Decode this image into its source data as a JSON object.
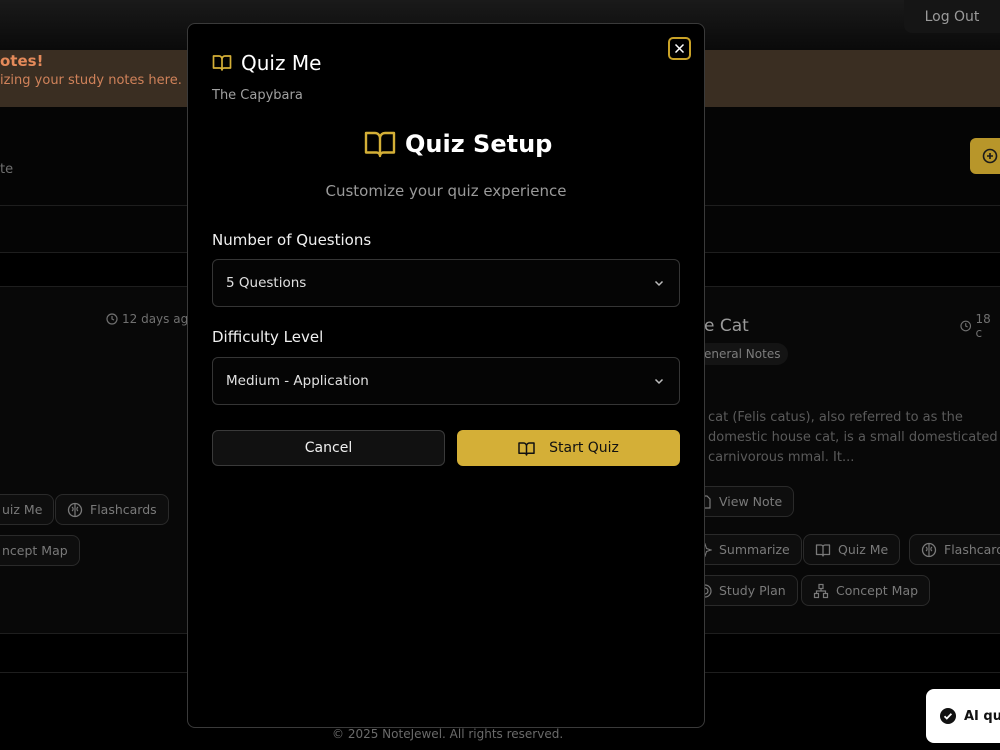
{
  "header": {
    "logout_label": "Log Out"
  },
  "banner": {
    "title": "otes!",
    "text": "izing your study notes here."
  },
  "section": {
    "partial_text": "te",
    "add_icon": "plus-circle-icon"
  },
  "left_card": {
    "time": "12 days ago",
    "actions": [
      "uiz Me",
      "Flashcards",
      "ncept Map"
    ]
  },
  "right_card": {
    "title": "e Cat",
    "time": "18 c",
    "tag": "eneral Notes",
    "excerpt": "cat (Felis catus), also referred to as the domestic house cat, is a small domesticated carnivorous mmal. It...",
    "view_label": "View Note",
    "actions": [
      "Summarize",
      "Quiz Me",
      "Flashcards",
      "Study Plan",
      "Concept Map"
    ]
  },
  "footer": {
    "copyright": "© 2025 NoteJewel. All rights reserved."
  },
  "toast": {
    "text": "AI qui"
  },
  "modal": {
    "title": "Quiz Me",
    "subtitle": "The Capybara",
    "setup_title": "Quiz Setup",
    "setup_subtitle": "Customize your quiz experience",
    "questions_label": "Number of Questions",
    "questions_value": "5 Questions",
    "difficulty_label": "Difficulty Level",
    "difficulty_value": "Medium - Application",
    "cancel_label": "Cancel",
    "start_label": "Start Quiz"
  },
  "colors": {
    "accent": "#d4af37",
    "background": "#000000",
    "banner": "#3a2e22"
  }
}
